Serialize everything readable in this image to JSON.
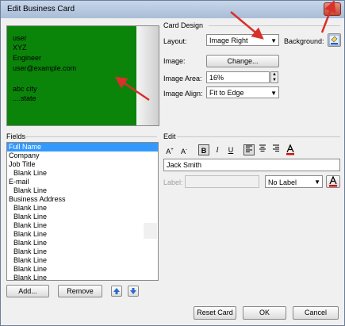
{
  "window": {
    "title": "Edit Business Card",
    "close_glyph": "X"
  },
  "card_preview": {
    "lines": [
      "user",
      "XYZ",
      "Engineer",
      "user@example.com",
      "",
      "abc city",
      "....state"
    ],
    "background_color": "#0a850a"
  },
  "card_design": {
    "header": "Card Design",
    "layout_label": "Layout:",
    "layout_value": "Image Right",
    "background_label": "Background:",
    "image_label": "Image:",
    "change_button": "Change...",
    "image_area_label": "Image Area:",
    "image_area_value": "16%",
    "image_align_label": "Image Align:",
    "image_align_value": "Fit to Edge"
  },
  "fields": {
    "header": "Fields",
    "items": [
      "Full Name",
      "Company",
      "Job Title",
      "Blank Line",
      "E-mail",
      "Blank Line",
      "Business Address",
      "Blank Line",
      "Blank Line",
      "Blank Line",
      "Blank Line",
      "Blank Line",
      "Blank Line",
      "Blank Line",
      "Blank Line",
      "Blank Line"
    ],
    "selected_index": 0,
    "add_button": "Add...",
    "remove_button": "Remove"
  },
  "edit": {
    "header": "Edit",
    "text_value": "Jack Smith",
    "label_label": "Label:",
    "label_select": "No Label"
  },
  "footer": {
    "reset_button": "Reset Card",
    "ok_button": "OK",
    "cancel_button": "Cancel"
  }
}
